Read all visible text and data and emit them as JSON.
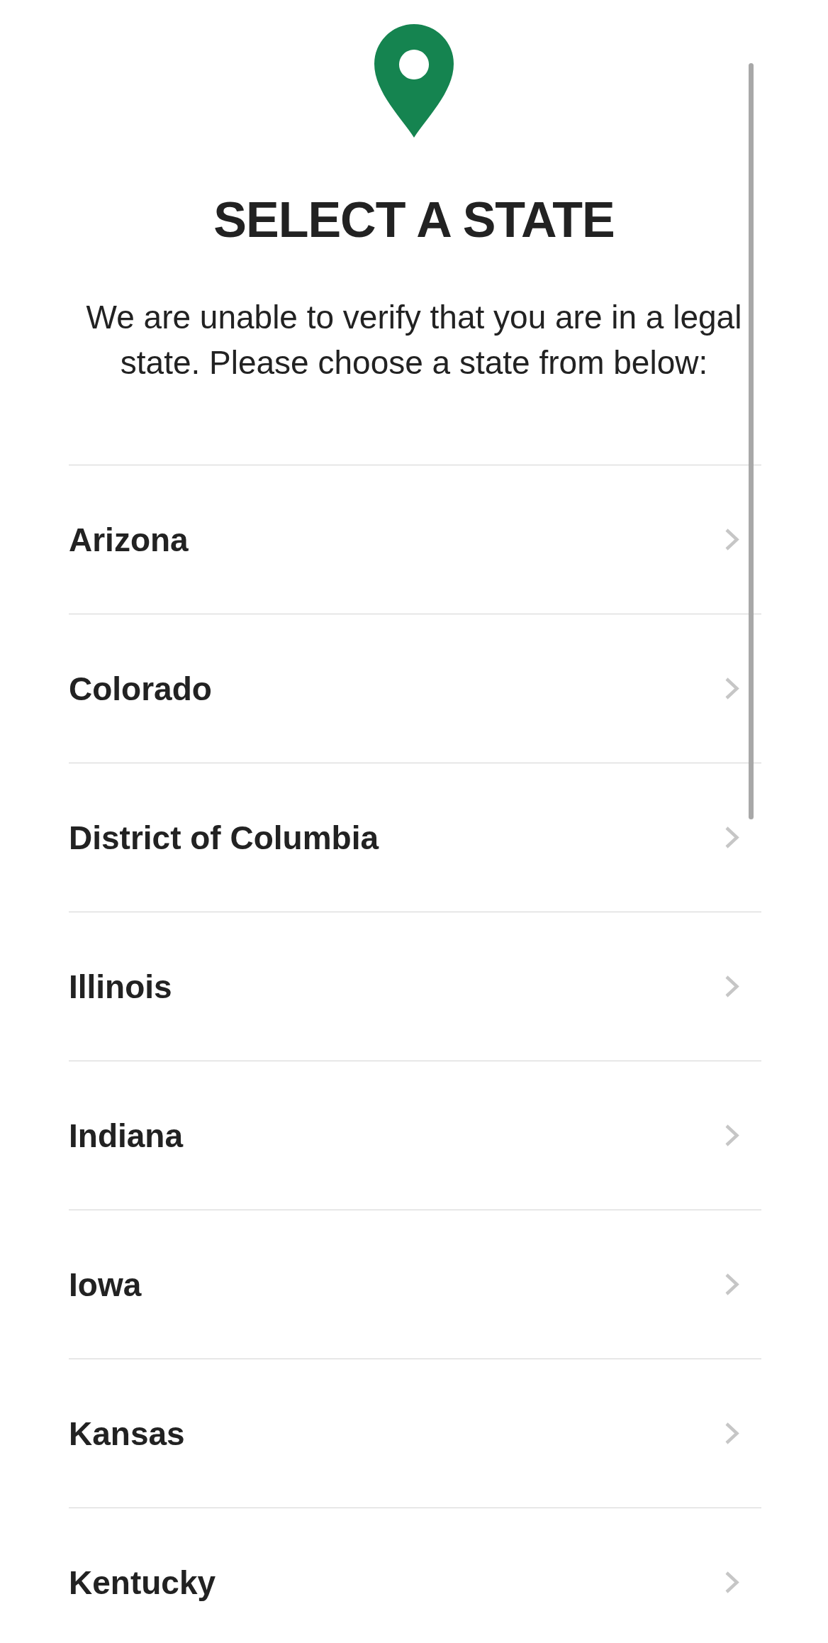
{
  "header": {
    "title": "SELECT A STATE",
    "message": "We are unable to verify that you are in a legal state. Please choose a state from below:"
  },
  "states": [
    "Arizona",
    "Colorado",
    "District of Columbia",
    "Illinois",
    "Indiana",
    "Iowa",
    "Kansas",
    "Kentucky"
  ]
}
